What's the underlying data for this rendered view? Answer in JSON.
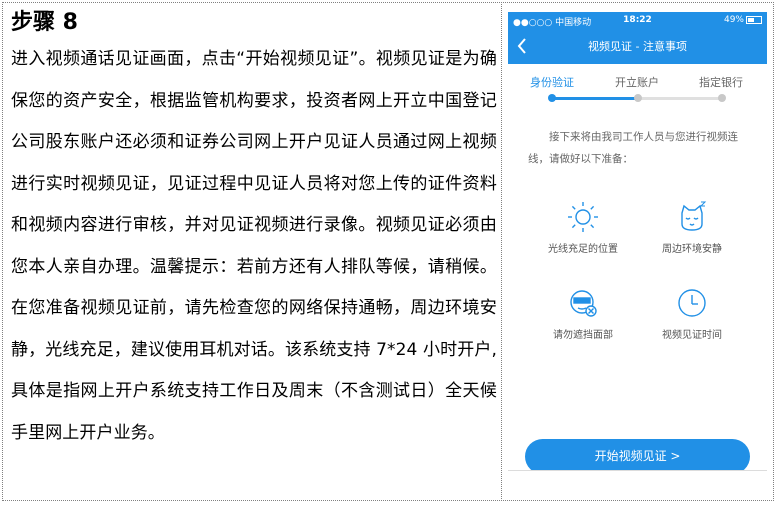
{
  "left": {
    "step_title": "步骤 8",
    "paragraph": "进入视频通话见证画面，点击“开始视频见证”。视频见证是为确保您的资产安全，根据监管机构要求，投资者网上开立中国登记公司股东账户还必须和证券公司网上开户见证人员通过网上视频进行实时视频见证，见证过程中见证人员将对您上传的证件资料和视频内容进行审核，并对见证视频进行录像。视频见证必须由您本人亲自办理。温馨提示：若前方还有人排队等候，请稍候。在您准备视频见证前，请先检查您的网络保持通畅，周边环境安静，光线充足，建议使用耳机对话。该系统支持 7*24 小时开户,具体是指网上开户系统支持工作日及周末（不含测试日）全天候手里网上开户业务。"
  },
  "phone": {
    "status": {
      "carrier": "●●○○○ 中国移动",
      "time": "18:22",
      "battery": "49%"
    },
    "nav": {
      "back_icon": "chevron-left-icon",
      "title": "视频见证 - 注意事项"
    },
    "steps": [
      {
        "label": "身份验证",
        "active": true
      },
      {
        "label": "开立账户",
        "active": false
      },
      {
        "label": "指定银行",
        "active": false
      }
    ],
    "intro": "接下来将由我司工作人员与您进行视频连线，请做好以下准备：",
    "tips": [
      {
        "icon": "sun-icon",
        "label": "光线充足的位置"
      },
      {
        "icon": "sleeping-cat-icon",
        "label": "周边环境安静"
      },
      {
        "icon": "covered-face-icon",
        "label": "请勿遮挡面部"
      },
      {
        "icon": "clock-icon",
        "label": "视频见证时间"
      }
    ],
    "start_button": "开始视频见证 >",
    "colors": {
      "accent": "#2190e6",
      "inactive": "#c8c8c8"
    }
  }
}
